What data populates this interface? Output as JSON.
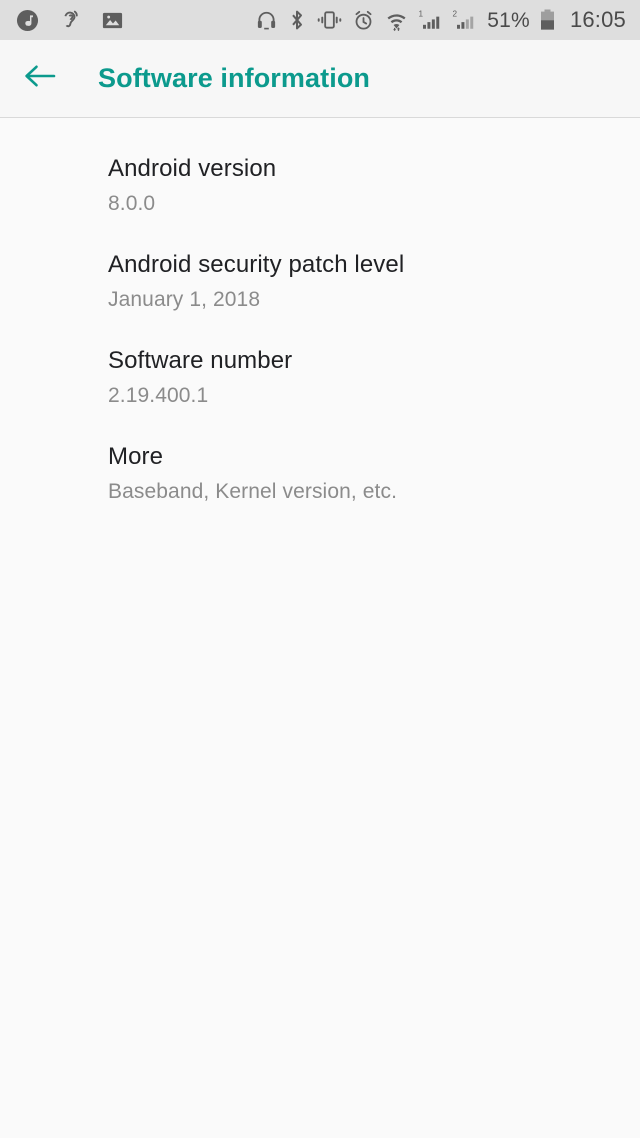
{
  "status_bar": {
    "background_color": "#dedede",
    "left_icons": [
      {
        "name": "music-note-icon",
        "label": "music playing"
      },
      {
        "name": "hearing-aid-icon",
        "label": "hearing"
      },
      {
        "name": "image-icon",
        "label": "screenshot captured"
      }
    ],
    "right_icons": [
      {
        "name": "headphones-icon",
        "label": "headphones connected"
      },
      {
        "name": "bluetooth-icon",
        "label": "bluetooth on"
      },
      {
        "name": "vibrate-icon",
        "label": "vibrate mode"
      },
      {
        "name": "alarm-clock-icon",
        "label": "alarm set"
      },
      {
        "name": "wifi-icon",
        "label": "wi-fi connected"
      },
      {
        "name": "signal-sim1-icon",
        "label": "SIM 1 signal"
      },
      {
        "name": "signal-sim2-icon",
        "label": "SIM 2 signal"
      }
    ],
    "sim1_label": "1",
    "sim2_label": "2",
    "battery_percent": "51%",
    "battery_level": 51,
    "battery_icon": "battery-icon",
    "clock": "16:05"
  },
  "app_bar": {
    "background_color": "#f7f7f7",
    "accent_color": "#0c9a8d",
    "back_icon": "back-arrow-icon",
    "title": "Software information"
  },
  "content": {
    "background_color": "#fafafa",
    "items": [
      {
        "title": "Android version",
        "subtitle": "8.0.0"
      },
      {
        "title": "Android security patch level",
        "subtitle": "January 1, 2018"
      },
      {
        "title": "Software number",
        "subtitle": "2.19.400.1"
      },
      {
        "title": "More",
        "subtitle": "Baseband, Kernel version, etc."
      }
    ]
  }
}
